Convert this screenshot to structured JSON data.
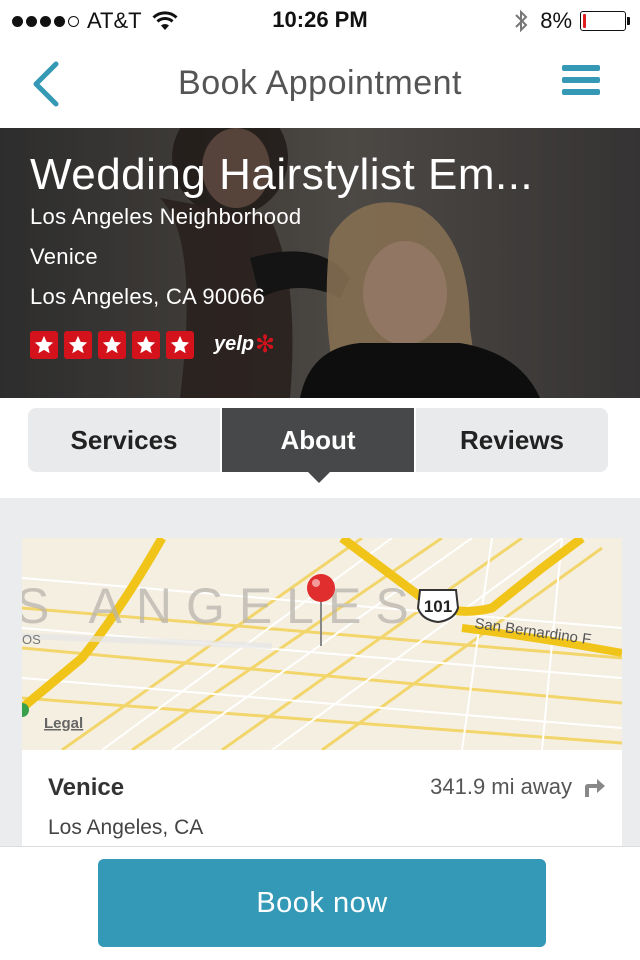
{
  "status_bar": {
    "carrier": "AT&T",
    "signal_bars_filled": 4,
    "signal_bars_total": 5,
    "time": "10:26 PM",
    "battery_percent_label": "8%",
    "battery_level": 0.08,
    "icons": [
      "signal-icon",
      "wifi-icon",
      "bluetooth-icon",
      "battery-icon"
    ]
  },
  "nav": {
    "title": "Book Appointment",
    "back_icon": "chevron-left-icon",
    "menu_icon": "hamburger-menu-icon",
    "accent_color": "#3599b5"
  },
  "hero": {
    "business_name": "Wedding Hairstylist Em...",
    "neighborhood": "Los Angeles Neighborhood",
    "area": "Venice",
    "city_line": "Los Angeles, CA 90066",
    "rating": 5,
    "rating_max": 5,
    "rating_source": "yelp",
    "star_color": "#d4121b"
  },
  "tabs": {
    "items": [
      {
        "label": "Services"
      },
      {
        "label": "About"
      },
      {
        "label": "Reviews"
      }
    ],
    "active_index": 1
  },
  "map": {
    "labels": {
      "area": "S ANGELES",
      "highway": "101",
      "street": "San Bernardino F",
      "left_fragment": "OS",
      "legal": "Legal"
    }
  },
  "location": {
    "name": "Venice",
    "city": "Los Angeles, CA",
    "distance": "341.9 mi away",
    "directions_icon": "directions-arrow-icon"
  },
  "cta": {
    "book_label": "Book now",
    "color": "#3399b6"
  }
}
